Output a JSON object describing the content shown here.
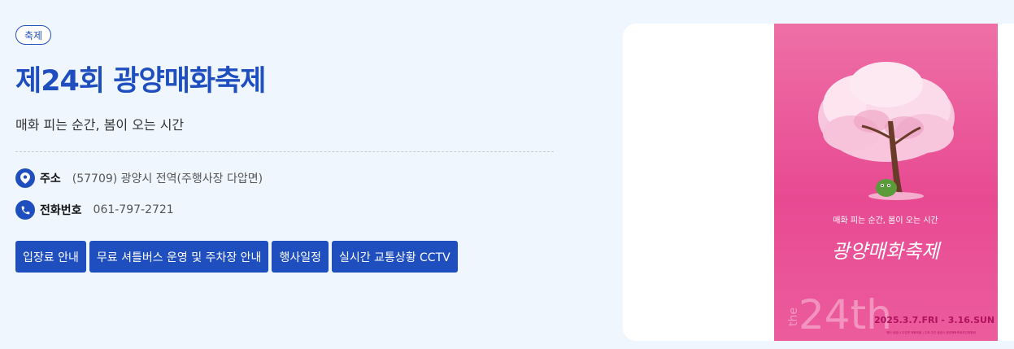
{
  "category_badge": "축제",
  "title": "제24회 광양매화축제",
  "subtitle": "매화 피는 순간, 봄이 오는 시간",
  "address": {
    "label": "주소",
    "value": "(57709) 광양시 전역(주행사장 다압면)"
  },
  "phone": {
    "label": "전화번호",
    "value": "061-797-2721"
  },
  "buttons": [
    "입장료 안내",
    "무료 셔틀버스 운영 및 주차장 안내",
    "행사일정",
    "실시간 교통상황 CCTV"
  ],
  "poster": {
    "tagline": "매화 피는 순간, 봄이 오는 시간",
    "title": "광양매화축제",
    "edition": "24th",
    "edition_prefix": "the",
    "dates": "2025.3.7.FRI - 3.16.SUN",
    "footer": "행사 광양시 다압면 매화마을 | 주최·주관 광양시 광양매화축제추진위원회"
  },
  "colors": {
    "primary": "#1f4fbf",
    "background": "#eff6fe",
    "poster_pink": "#e84a92"
  },
  "icons": {
    "address": "location-pin-icon",
    "phone": "phone-icon"
  }
}
